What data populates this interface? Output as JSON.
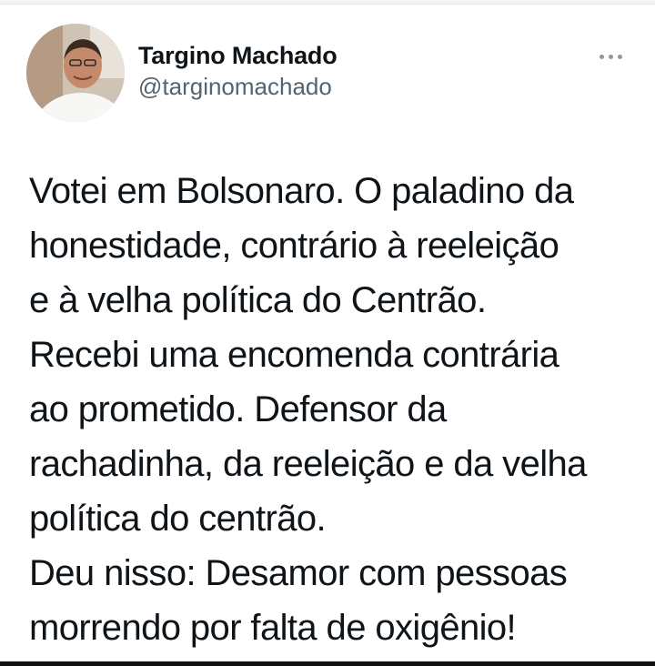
{
  "tweet": {
    "author": {
      "display_name": "Targino Machado",
      "handle": "@targinomachado"
    },
    "more_icon": "ellipsis-icon",
    "text_lines": [
      "Votei em Bolsonaro. O paladino da",
      "honestidade, contrário à reeleição",
      "e à velha política do Centrão.",
      "Recebi uma encomenda contrária",
      "ao prometido. Defensor da",
      "rachadinha, da reeleição e da velha",
      "política do centrão.",
      "Deu nisso: Desamor com pessoas",
      "morrendo por falta de oxigênio!"
    ]
  },
  "colors": {
    "text": "#0f1419",
    "secondary": "#536471",
    "icon": "#8b98a5"
  }
}
